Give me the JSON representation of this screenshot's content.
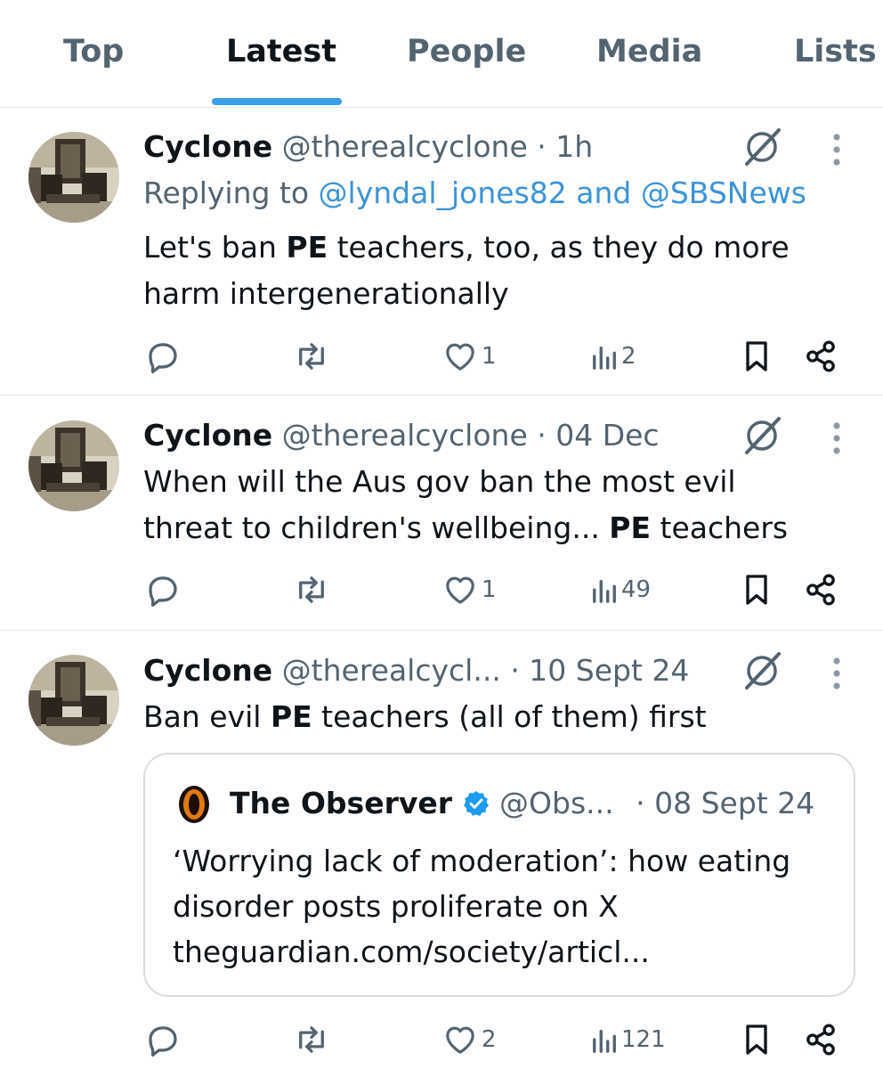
{
  "tabs": [
    {
      "label": "Top",
      "active": false
    },
    {
      "label": "Latest",
      "active": true
    },
    {
      "label": "People",
      "active": false
    },
    {
      "label": "Media",
      "active": false
    },
    {
      "label": "Lists",
      "active": false
    }
  ],
  "accent_color": "#1d9bf0",
  "tweets": [
    {
      "name": "Cyclone",
      "handle": "@therealcyclone",
      "time": "· 1h",
      "replying_prefix": "Replying to ",
      "replying_user1": "@lyndal_jones82",
      "replying_and": " and ",
      "replying_user2": "@SBSNews",
      "text_lines": [
        {
          "pre": "Let's ban ",
          "bold": "PE",
          "post": " teachers, too, as they do more"
        },
        {
          "pre": "harm intergenerationally",
          "bold": "",
          "post": ""
        }
      ],
      "actions": {
        "replies": "",
        "reposts": "",
        "likes": "1",
        "views": "2"
      }
    },
    {
      "name": "Cyclone",
      "handle": "@therealcyclone",
      "time": "· 04 Dec",
      "text_lines": [
        {
          "pre": "When will the Aus gov ban the most evil",
          "bold": "",
          "post": ""
        },
        {
          "pre": "threat to children's wellbeing... ",
          "bold": "PE",
          "post": " teachers"
        }
      ],
      "actions": {
        "replies": "",
        "reposts": "",
        "likes": "1",
        "views": "49"
      }
    },
    {
      "name": "Cyclone",
      "handle": "@therealcycl...",
      "time": "· 10 Sept 24",
      "text_lines": [
        {
          "pre": "Ban evil ",
          "bold": "PE",
          "post": " teachers (all of them) first"
        }
      ],
      "quote": {
        "name": "The Observer",
        "verified": true,
        "handle": "@Obs...",
        "time": "· 08 Sept 24",
        "lines": [
          "‘Worrying lack of moderation’: how eating",
          "disorder posts proliferate on X",
          "theguardian.com/society/articl..."
        ]
      },
      "actions": {
        "replies": "",
        "reposts": "",
        "likes": "2",
        "views": "121"
      }
    }
  ],
  "icons": {
    "reply": "reply-icon",
    "repost": "repost-icon",
    "like": "heart-icon",
    "views": "views-icon",
    "bookmark": "bookmark-icon",
    "share": "share-icon",
    "grok": "grok-icon",
    "more": "more-vertical-icon"
  }
}
